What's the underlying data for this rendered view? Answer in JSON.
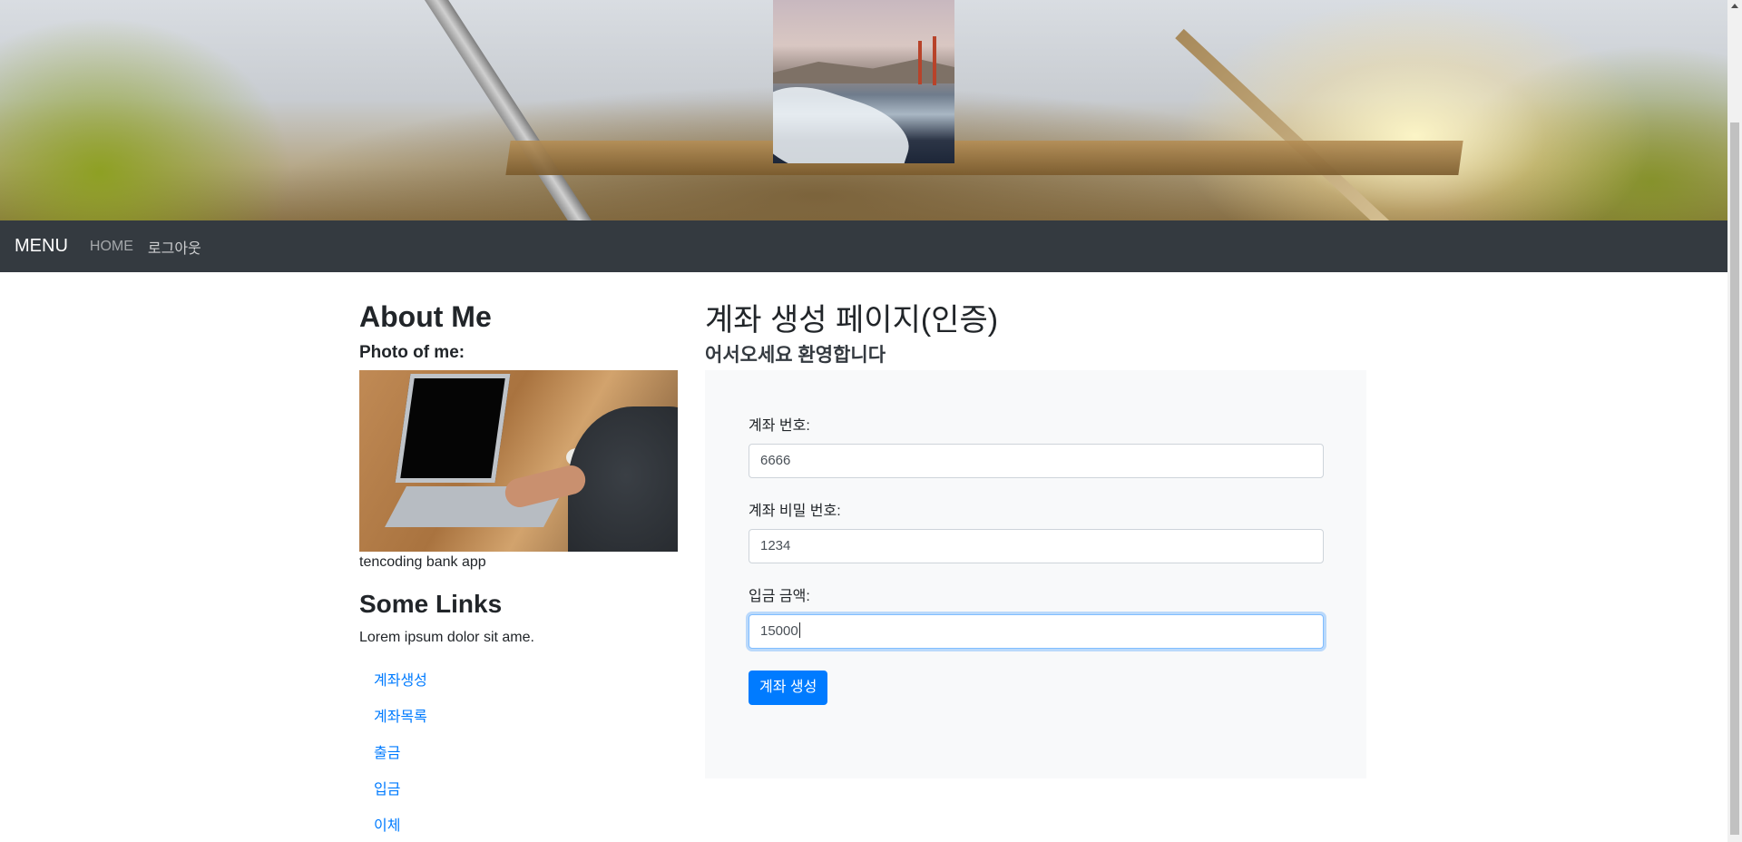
{
  "navbar": {
    "brand": "MENU",
    "links": [
      {
        "label": "HOME"
      },
      {
        "label": "로그아웃"
      }
    ]
  },
  "sidebar": {
    "about_title": "About Me",
    "photo_label": "Photo of me:",
    "caption": "tencoding bank app",
    "links_title": "Some Links",
    "lorem": "Lorem ipsum dolor sit ame.",
    "links": [
      {
        "label": "계좌생성"
      },
      {
        "label": "계좌목록"
      },
      {
        "label": "출금"
      },
      {
        "label": "입금"
      },
      {
        "label": "이체"
      }
    ]
  },
  "main": {
    "title": "계좌 생성 페이지(인증)",
    "subtitle": "어서오세요 환영합니다",
    "form": {
      "fields": [
        {
          "label": "계좌 번호:",
          "value": "6666"
        },
        {
          "label": "계좌 비밀 번호:",
          "value": "1234"
        },
        {
          "label": "입금 금액:",
          "value": "15000",
          "focused": true
        }
      ],
      "submit_label": "계좌 생성"
    }
  },
  "icons": {
    "scroll_up": "scroll-up-arrow-icon"
  },
  "colors": {
    "navbar_bg": "#343a40",
    "primary": "#007bff",
    "panel_bg": "#f8f9fa"
  }
}
